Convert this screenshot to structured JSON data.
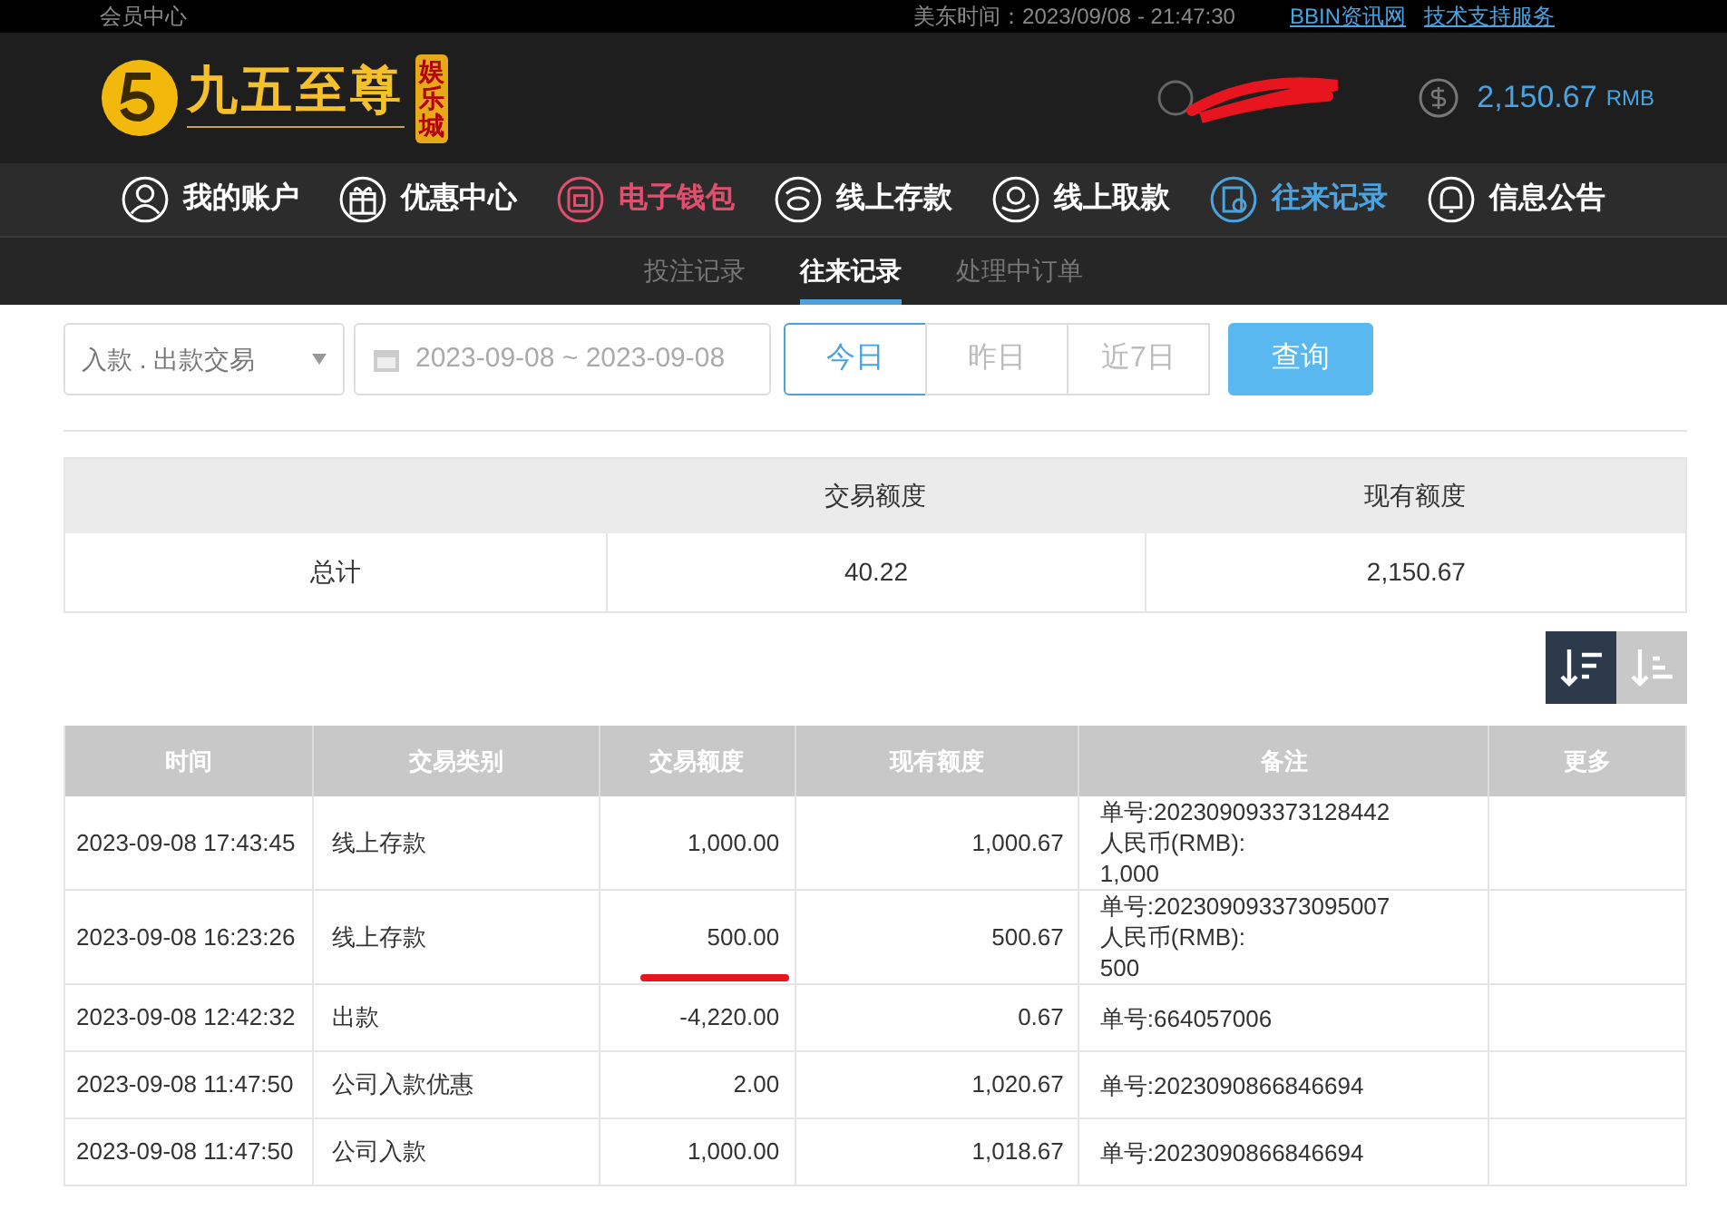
{
  "top_bar": {
    "left": "会员中心",
    "time": "美东时间：2023/09/08 - 21:47:30",
    "links": [
      "BBIN资讯网",
      "技术支持服务"
    ]
  },
  "header": {
    "logo_text": "九五至尊",
    "logo_badge": "娱乐城",
    "balance": "2,150.67",
    "currency": "RMB"
  },
  "nav": [
    {
      "label": "我的账户",
      "color": "#ffffff"
    },
    {
      "label": "优惠中心",
      "color": "#ffffff"
    },
    {
      "label": "电子钱包",
      "color": "#e0506e"
    },
    {
      "label": "线上存款",
      "color": "#ffffff"
    },
    {
      "label": "线上取款",
      "color": "#ffffff"
    },
    {
      "label": "往来记录",
      "color": "#4aa3df"
    },
    {
      "label": "信息公告",
      "color": "#ffffff"
    }
  ],
  "sub_tabs": [
    {
      "label": "投注记录",
      "selected": false
    },
    {
      "label": "往来记录",
      "selected": true
    },
    {
      "label": "处理中订单",
      "selected": false
    }
  ],
  "filters": {
    "type": "入款 . 出款交易",
    "date_range": "2023-09-08 ~ 2023-09-08",
    "ranges": [
      {
        "label": "今日",
        "selected": true
      },
      {
        "label": "昨日",
        "selected": false
      },
      {
        "label": "近7日",
        "selected": false
      }
    ],
    "query": "查询"
  },
  "summary": {
    "columns": [
      "交易额度",
      "现有额度"
    ],
    "row": [
      "总计",
      "40.22",
      "2,150.67"
    ]
  },
  "sort_buttons": [
    {
      "selected": true
    },
    {
      "selected": false
    }
  ],
  "table": {
    "columns": [
      "时间",
      "交易类别",
      "交易额度",
      "现有额度",
      "备注",
      "更多"
    ],
    "rows": [
      {
        "time": "2023-09-08 17:43:45",
        "type": "线上存款",
        "amount": "1,000.00",
        "balance": "1,000.67",
        "note": [
          "单号:202309093373128442",
          "人民币(RMB):",
          "1,000"
        ],
        "marked": false
      },
      {
        "time": "2023-09-08 16:23:26",
        "type": "线上存款",
        "amount": "500.00",
        "balance": "500.67",
        "note": [
          "单号:202309093373095007",
          "人民币(RMB):",
          "500"
        ],
        "marked": true
      },
      {
        "time": "2023-09-08 12:42:32",
        "type": "出款",
        "amount": "-4,220.00",
        "balance": "0.67",
        "note": [
          "单号:664057006"
        ],
        "marked": false
      },
      {
        "time": "2023-09-08 11:47:50",
        "type": "公司入款优惠",
        "amount": "2.00",
        "balance": "1,020.67",
        "note": [
          "单号:2023090866846694"
        ],
        "marked": false
      },
      {
        "time": "2023-09-08 11:47:50",
        "type": "公司入款",
        "amount": "1,000.00",
        "balance": "1,018.67",
        "note": [
          "单号:2023090866846694"
        ],
        "marked": false
      }
    ]
  }
}
